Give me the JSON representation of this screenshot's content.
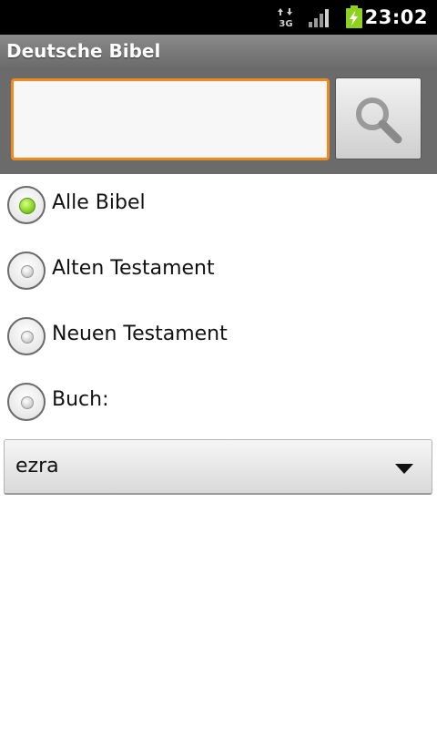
{
  "status_bar": {
    "time": "23:02",
    "network_label": "3G",
    "icons": [
      "data-arrows-icon",
      "signal-icon",
      "battery-charging-icon"
    ]
  },
  "app": {
    "title": "Deutsche Bibel"
  },
  "search": {
    "query": "",
    "button_icon": "search-icon"
  },
  "scope_options": [
    {
      "label": "Alle Bibel",
      "checked": true
    },
    {
      "label": "Alten Testament",
      "checked": false
    },
    {
      "label": "Neuen Testament",
      "checked": false
    },
    {
      "label": "Buch:",
      "checked": false
    }
  ],
  "book_spinner": {
    "selected": "ezra"
  },
  "colors": {
    "accent_focus": "#f08a1c",
    "radio_checked": "#8ed62a",
    "title_bar": "#7a7a7a",
    "search_bar": "#6b6b6b"
  }
}
